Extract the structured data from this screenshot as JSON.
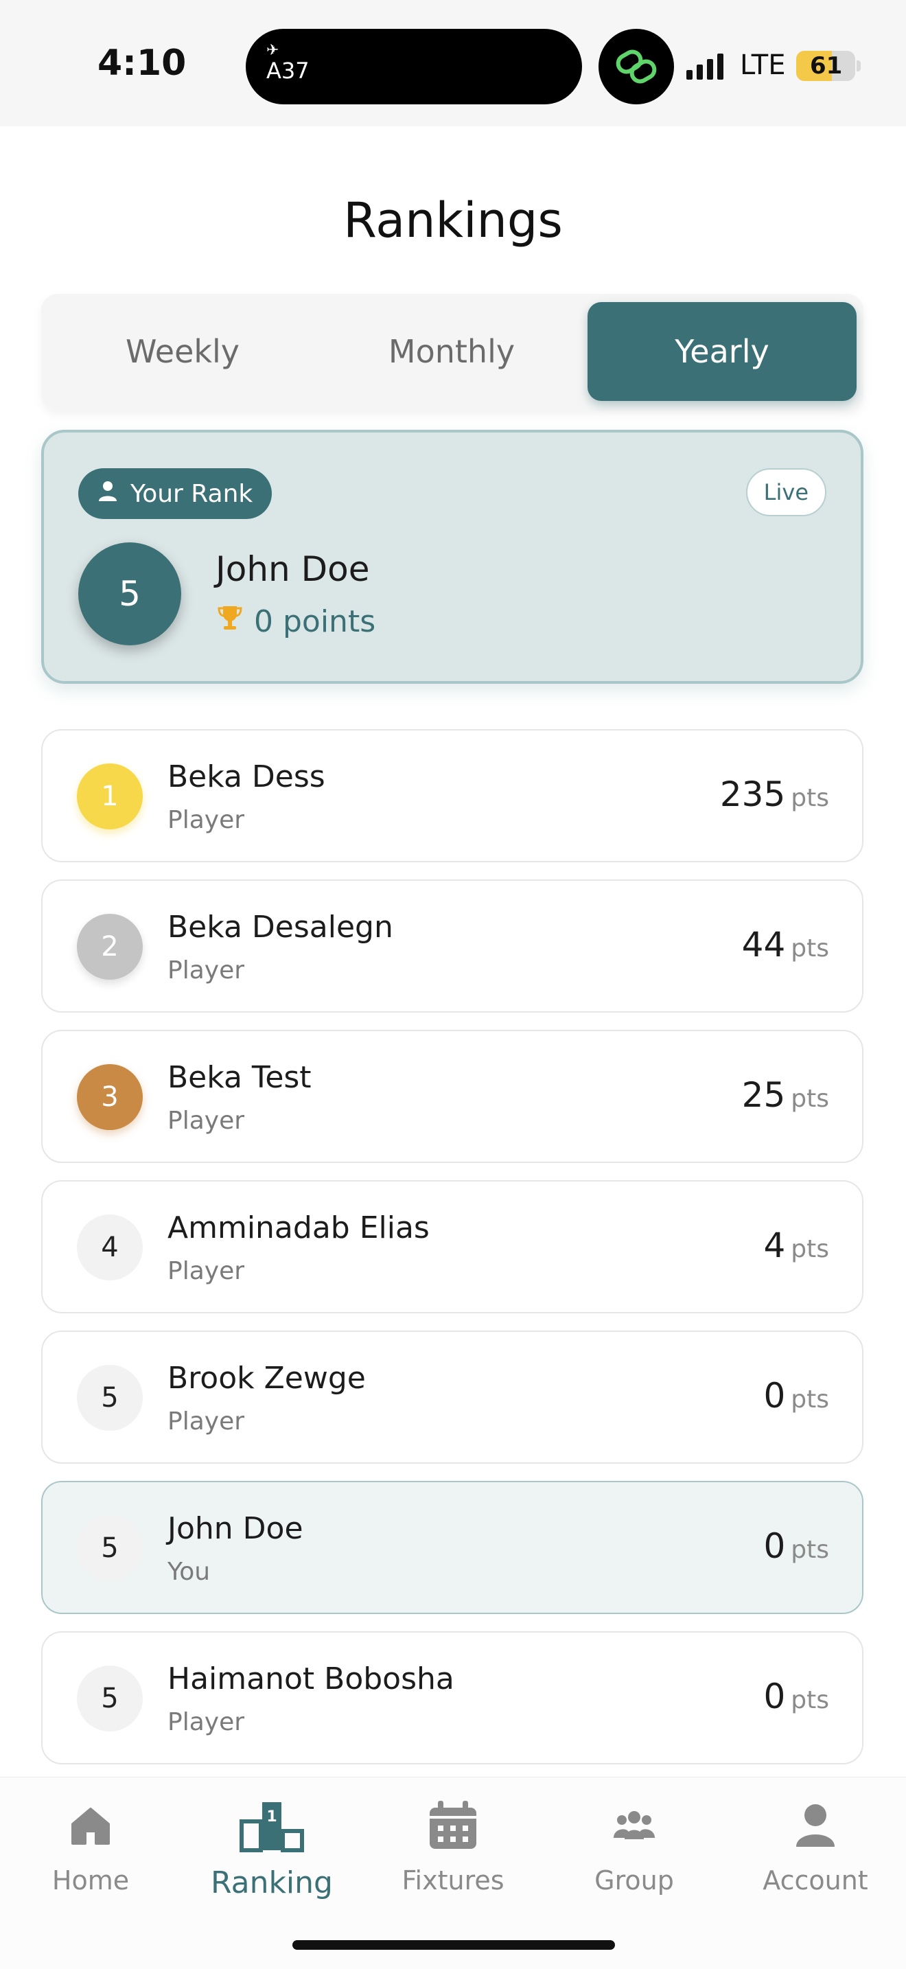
{
  "status_bar": {
    "time": "4:10",
    "flight_code": "A37",
    "network": "LTE",
    "battery": "61",
    "battery_level": 0.61
  },
  "page": {
    "title": "Rankings"
  },
  "tabs": [
    {
      "label": "Weekly",
      "active": false
    },
    {
      "label": "Monthly",
      "active": false
    },
    {
      "label": "Yearly",
      "active": true
    }
  ],
  "your_rank": {
    "badge_label": "Your Rank",
    "live_label": "Live",
    "rank": "5",
    "name": "John Doe",
    "points_text": "0 points"
  },
  "rankings": [
    {
      "rank": "1",
      "name": "Beka Dess",
      "role": "Player",
      "points": "235",
      "unit": "pts"
    },
    {
      "rank": "2",
      "name": "Beka Desalegn",
      "role": "Player",
      "points": "44",
      "unit": "pts"
    },
    {
      "rank": "3",
      "name": "Beka Test",
      "role": "Player",
      "points": "25",
      "unit": "pts"
    },
    {
      "rank": "4",
      "name": "Amminadab Elias",
      "role": "Player",
      "points": "4",
      "unit": "pts"
    },
    {
      "rank": "5",
      "name": "Brook Zewge",
      "role": "Player",
      "points": "0",
      "unit": "pts"
    },
    {
      "rank": "5",
      "name": "John Doe",
      "role": "You",
      "points": "0",
      "unit": "pts"
    },
    {
      "rank": "5",
      "name": "Haimanot Bobosha",
      "role": "Player",
      "points": "0",
      "unit": "pts"
    }
  ],
  "bottom_nav": [
    {
      "label": "Home",
      "icon": "home-icon",
      "active": false
    },
    {
      "label": "Ranking",
      "icon": "podium-icon",
      "active": true
    },
    {
      "label": "Fixtures",
      "icon": "calendar-icon",
      "active": false
    },
    {
      "label": "Group",
      "icon": "group-icon",
      "active": false
    },
    {
      "label": "Account",
      "icon": "user-icon",
      "active": false
    }
  ],
  "colors": {
    "accent": "#3b7176",
    "gold": "#f6d84a",
    "silver": "#c4c4c4",
    "bronze": "#c98a45",
    "trophy": "#f0a820"
  }
}
